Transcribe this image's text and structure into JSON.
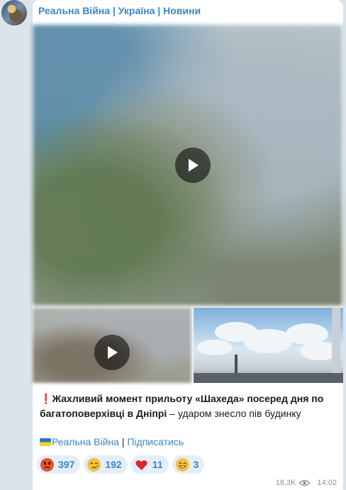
{
  "channel": {
    "name": "Реальна Війна | Україна | Новини"
  },
  "post": {
    "text_bold": "Жахливий момент прильоту «Шахеда» посеред дня по багатоповерхівці в Дніпрі",
    "text_rest": " – ударом знесло пів будинку",
    "signature_link": "Реальна Війна",
    "separator": " | ",
    "subscribe_link": "Підписатись"
  },
  "reactions": [
    {
      "icon": "angry-face-emoji",
      "count": "397"
    },
    {
      "icon": "crying-face-emoji",
      "count": "192"
    },
    {
      "icon": "red-heart-emoji",
      "count": "11"
    },
    {
      "icon": "grinning-face-emoji",
      "count": "3"
    }
  ],
  "meta": {
    "views": "18.3K",
    "time": "14:02"
  },
  "colors": {
    "accent": "#3a86c8",
    "reaction_bg": "#e3eef8",
    "chat_bg": "#dbe4ec"
  }
}
